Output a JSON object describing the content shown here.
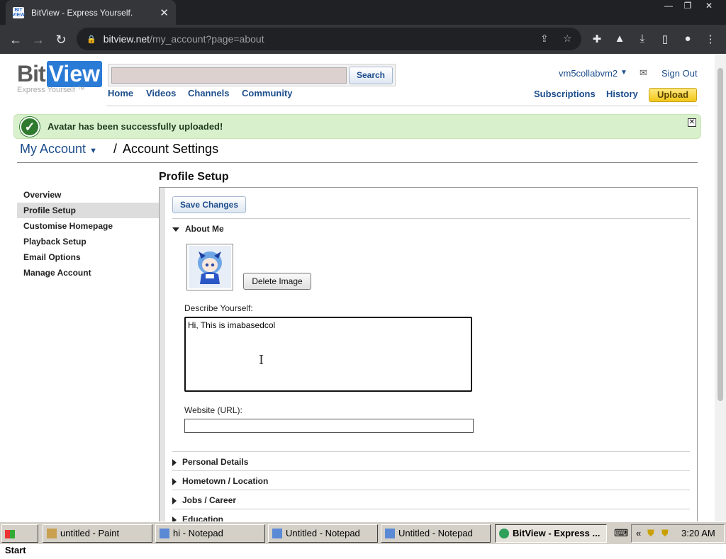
{
  "browser": {
    "tab_title": "BitView - Express Yourself.",
    "favicon_text": "BIT VIEW",
    "url_domain": "bitview.net",
    "url_path": "/my_account?page=about"
  },
  "site": {
    "logo_bit": "Bit",
    "logo_view": "View",
    "logo_tagline": "Express Yourself ™",
    "search_button": "Search",
    "nav": [
      "Home",
      "Videos",
      "Channels",
      "Community"
    ],
    "username": "vm5collabvm2",
    "sign_out": "Sign Out",
    "subscriptions": "Subscriptions",
    "history": "History",
    "upload": "Upload"
  },
  "alert": {
    "message": "Avatar has been successfully uploaded!"
  },
  "breadcrumb": {
    "account": "My Account",
    "separator": "/",
    "current": "Account Settings"
  },
  "page_title": "Profile Setup",
  "sidebar": [
    "Overview",
    "Profile Setup",
    "Customise Homepage",
    "Playback Setup",
    "Email Options",
    "Manage Account"
  ],
  "panel": {
    "save_button": "Save Changes",
    "about_me": "About Me",
    "delete_image": "Delete Image",
    "describe_label": "Describe Yourself:",
    "describe_value": "Hi, This is imabasedcol",
    "website_label": "Website (URL):",
    "website_value": "",
    "sections": [
      "Personal Details",
      "Hometown / Location",
      "Jobs / Career",
      "Education"
    ]
  },
  "taskbar": {
    "start": "Start",
    "tasks": [
      "untitled - Paint",
      "hi - Notepad",
      "Untitled - Notepad",
      "Untitled - Notepad",
      "BitView - Express ..."
    ],
    "clock": "3:20 AM",
    "tray_chevron": "«"
  }
}
